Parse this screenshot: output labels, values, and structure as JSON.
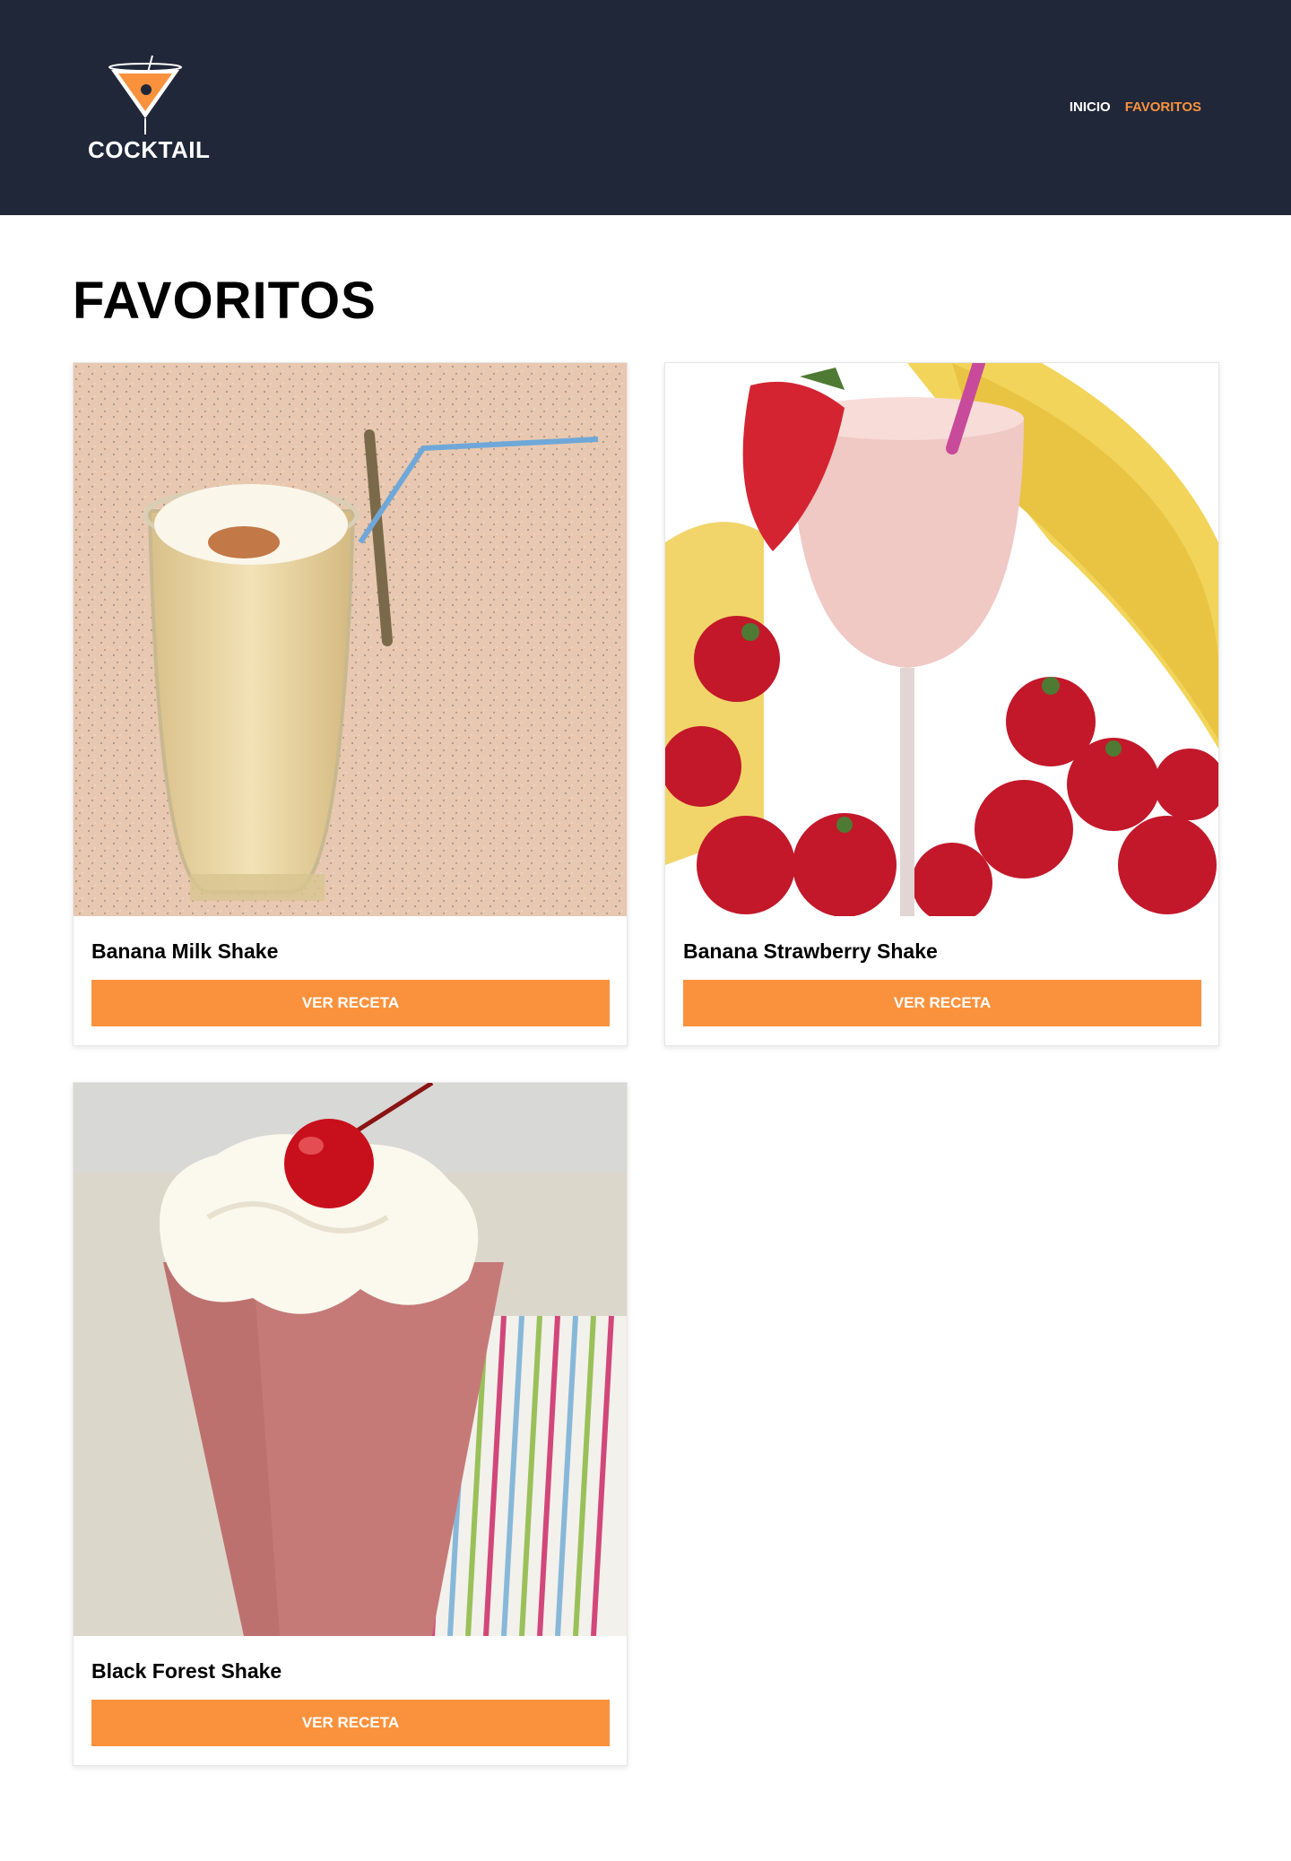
{
  "header": {
    "logo_text": "COCKTAIL",
    "nav": [
      {
        "label": "INICIO"
      },
      {
        "label": "FAVORITOS"
      }
    ],
    "colors": {
      "background": "#1f2739",
      "accent": "#fa923d",
      "nav_text": "#ffffff"
    }
  },
  "main": {
    "title": "FAVORITOS",
    "cards": [
      {
        "name": "Banana Milk Shake",
        "button_label": "VER RECETA",
        "image": "banana-milk-shake-photo"
      },
      {
        "name": "Banana Strawberry Shake",
        "button_label": "VER RECETA",
        "image": "banana-strawberry-shake-photo"
      },
      {
        "name": "Black Forest Shake",
        "button_label": "VER RECETA",
        "image": "black-forest-shake-photo"
      }
    ]
  }
}
